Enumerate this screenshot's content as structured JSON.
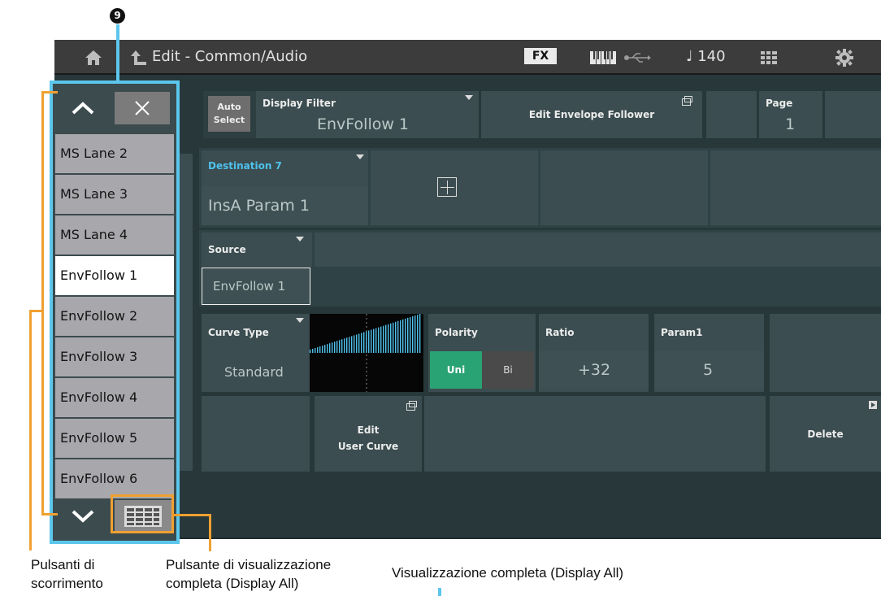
{
  "topbar": {
    "title": "Edit - Common/Audio",
    "fx_label": "FX",
    "tempo": "♩ 140",
    "icons": [
      "home-icon",
      "back-arrow-icon",
      "keyboard-icon",
      "usb-icon",
      "grid-icon",
      "gear-icon"
    ]
  },
  "toolbar": {
    "auto_select_label_1": "Auto",
    "auto_select_label_2": "Select",
    "display_filter_label": "Display Filter",
    "display_filter_value": "EnvFollow 1",
    "edit_envelope_follower_label": "Edit Envelope Follower",
    "page_label": "Page",
    "page_value": "1"
  },
  "destination": {
    "label": "Destination 7",
    "value": "InsA Param 1"
  },
  "source": {
    "label": "Source",
    "value": "EnvFollow 1"
  },
  "params": {
    "curve_type_label": "Curve Type",
    "curve_type_value": "Standard",
    "polarity_label": "Polarity",
    "polarity_uni": "Uni",
    "polarity_bi": "Bi",
    "ratio_label": "Ratio",
    "ratio_value": "+32",
    "param1_label": "Param1",
    "param1_value": "5",
    "edit_user_curve_1": "Edit",
    "edit_user_curve_2": "User Curve",
    "delete_label": "Delete"
  },
  "list": {
    "items": [
      "MS Lane 2",
      "MS Lane 3",
      "MS Lane 4",
      "EnvFollow 1",
      "EnvFollow 2",
      "EnvFollow 3",
      "EnvFollow 4",
      "EnvFollow 5",
      "EnvFollow 6"
    ],
    "selected_index": 3
  },
  "annotations": {
    "badge": "9",
    "scroll_caption_1": "Pulsanti di",
    "scroll_caption_2": "scorrimento",
    "display_all_caption_1": "Pulsante di visualizzazione",
    "display_all_caption_2": "completa (Display All)",
    "display_all_view_caption": "Visualizzazione completa (Display All)"
  },
  "colors": {
    "accent_blue": "#5cc6ec",
    "polarity_active": "#2aa374",
    "annotation_orange": "#f0a031",
    "destination_label": "#4fc1ec"
  }
}
